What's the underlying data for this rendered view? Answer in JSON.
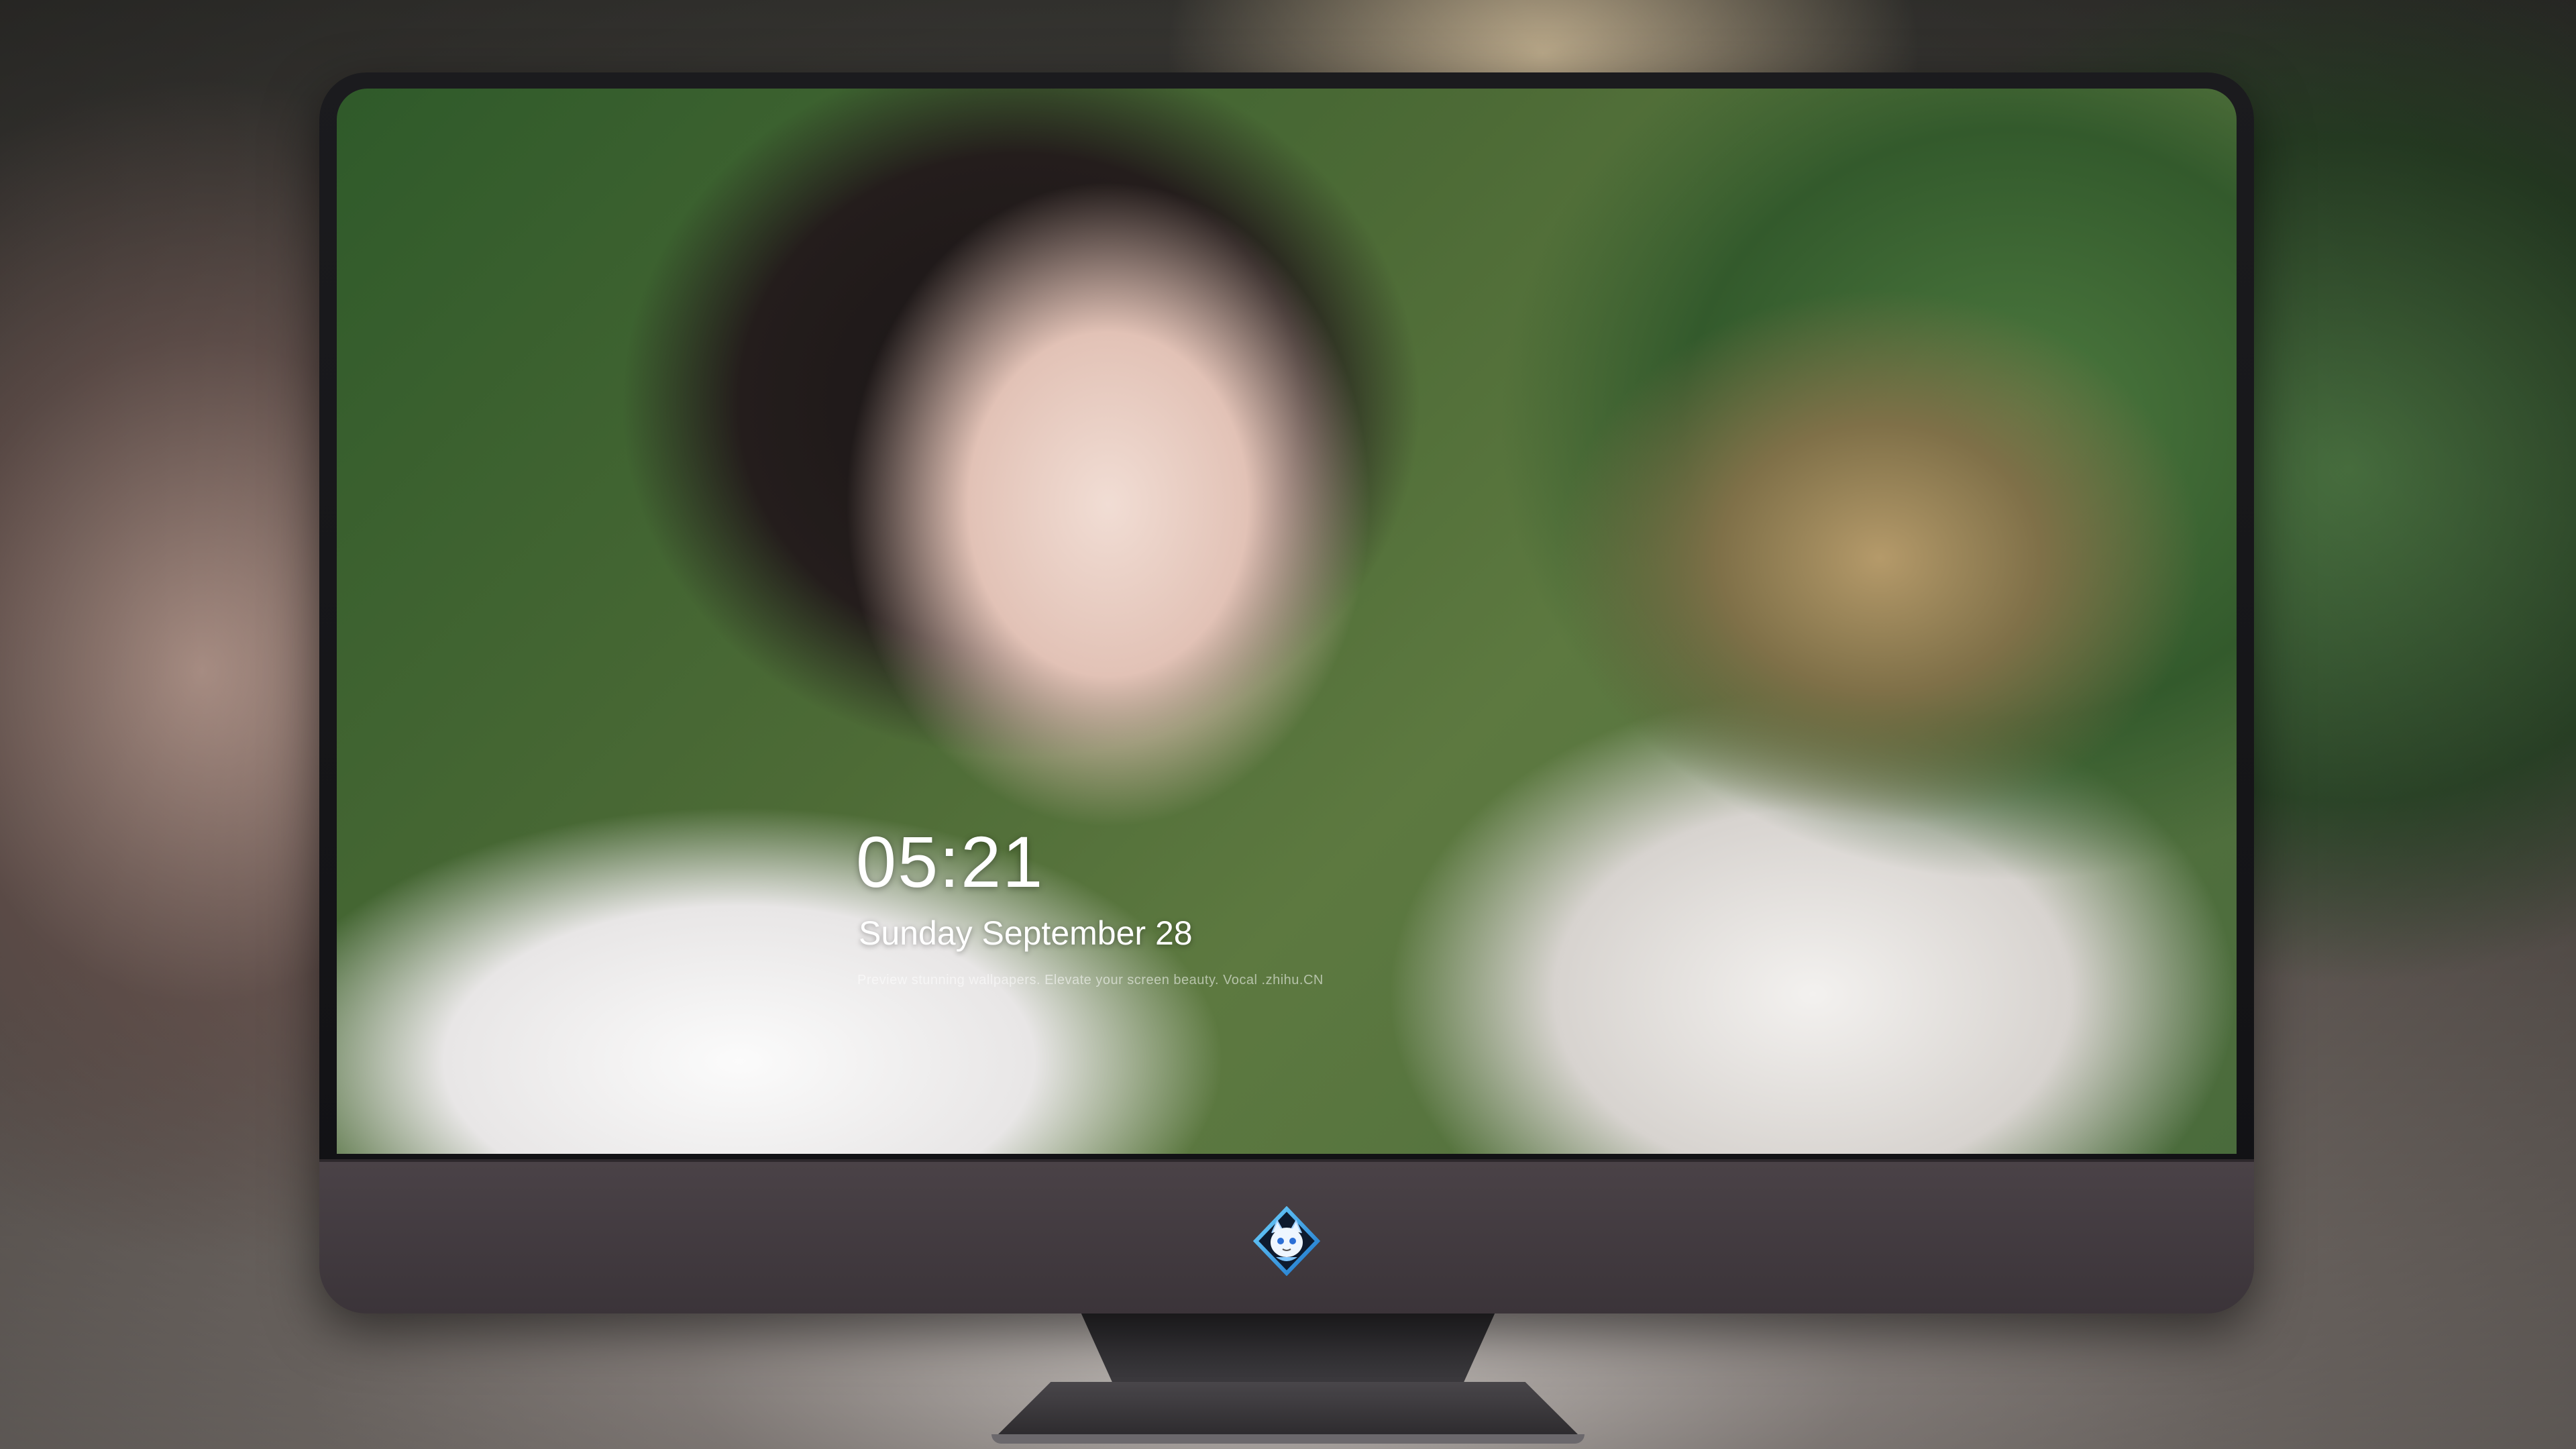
{
  "lock_screen": {
    "time": "05:21",
    "date": "Sunday September  28",
    "subtitle": "Preview stunning wallpapers. Elevate your screen beauty. Vocal .zhihu.CN"
  },
  "dock": {
    "apps": [
      {
        "id": "messages",
        "icon": "messages-icon",
        "color": "#34c759"
      },
      {
        "id": "weather",
        "icon": "weather-icon",
        "color": "#2d8cf0"
      },
      {
        "id": "clock",
        "icon": "clock-icon",
        "color": "#ffffff"
      },
      {
        "id": "preview",
        "icon": "preview-icon",
        "color": "#f2c94c"
      },
      {
        "id": "clips",
        "icon": "clips-icon",
        "color": "#33b5e5"
      },
      {
        "id": "notes",
        "icon": "notes-icon",
        "color": "#ffd93b"
      },
      {
        "id": "photo-browser",
        "icon": "photo-browser-icon",
        "color": "#e0e0e0"
      },
      {
        "id": "music",
        "icon": "music-icon",
        "color": "#fa3e87"
      },
      {
        "id": "app-store",
        "icon": "app-store-icon",
        "color": "#1e90ff"
      },
      {
        "id": "camera",
        "icon": "camera-icon",
        "color": "#7a7a7a"
      }
    ]
  },
  "monitor": {
    "logo": "cat-mascot-logo-icon"
  }
}
